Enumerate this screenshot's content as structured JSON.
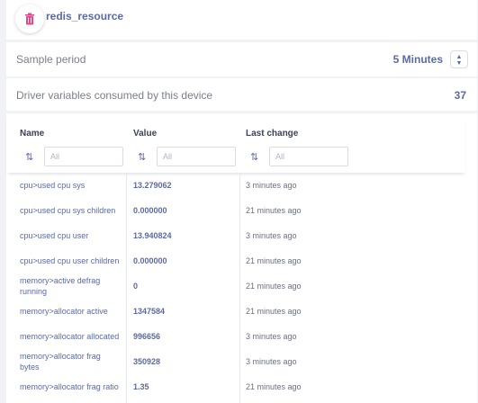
{
  "header": {
    "title": "redis_resource",
    "icon": "trash-icon",
    "icon_color": "#e04a8c"
  },
  "sample": {
    "label": "Sample period",
    "value": "5 Minutes"
  },
  "driver": {
    "label": "Driver variables consumed by this device",
    "count": "37"
  },
  "table": {
    "columns": [
      {
        "label": "Name",
        "placeholder": "All"
      },
      {
        "label": "Value",
        "placeholder": "All"
      },
      {
        "label": "Last change",
        "placeholder": "All"
      }
    ],
    "rows": [
      {
        "name": "cpu>used cpu sys",
        "value": "13.279062",
        "change": "3 minutes ago"
      },
      {
        "name": "cpu>used cpu sys children",
        "value": "0.000000",
        "change": "21 minutes ago"
      },
      {
        "name": "cpu>used cpu user",
        "value": "13.940824",
        "change": "3 minutes ago"
      },
      {
        "name": "cpu>used cpu user children",
        "value": "0.000000",
        "change": "21 minutes ago"
      },
      {
        "name": "memory>active defrag running",
        "value": "0",
        "change": "21 minutes ago"
      },
      {
        "name": "memory>allocator active",
        "value": "1347584",
        "change": "21 minutes ago"
      },
      {
        "name": "memory>allocator allocated",
        "value": "996656",
        "change": "3 minutes ago"
      },
      {
        "name": "memory>allocator frag bytes",
        "value": "350928",
        "change": "3 minutes ago"
      },
      {
        "name": "memory>allocator frag ratio",
        "value": "1.35",
        "change": "21 minutes ago"
      }
    ]
  }
}
